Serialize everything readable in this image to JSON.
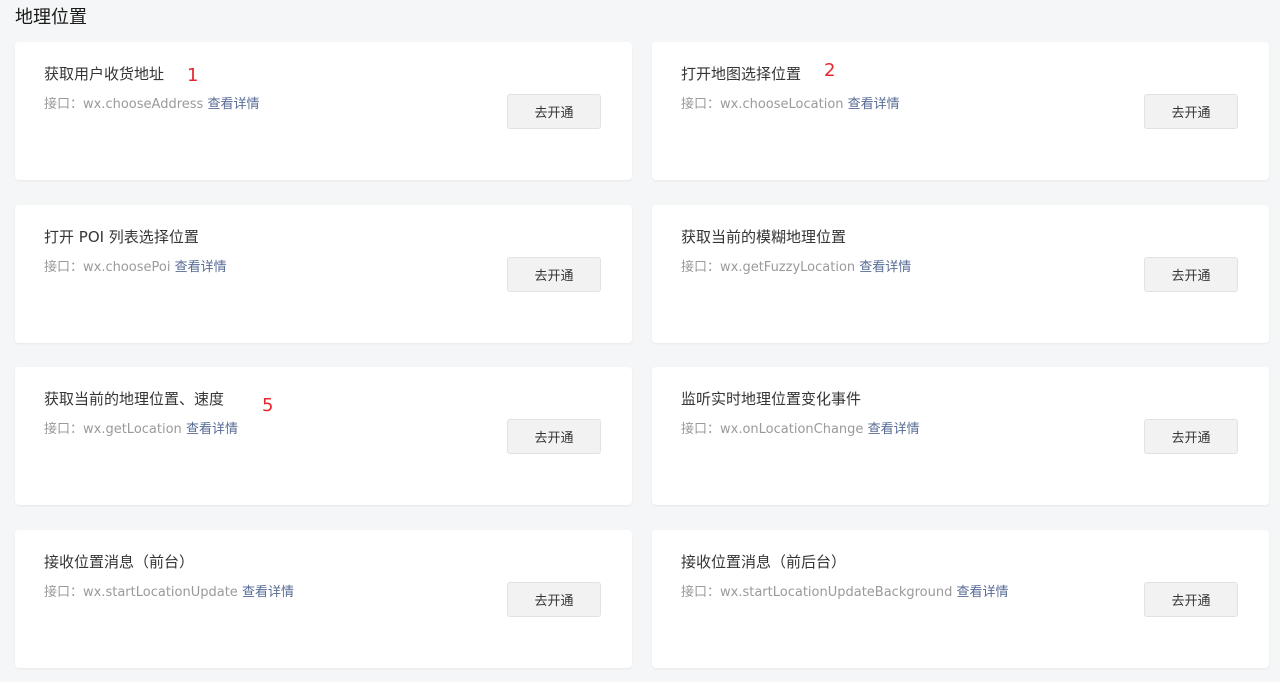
{
  "section_title": "地理位置",
  "cards": [
    {
      "title": "获取用户收货地址",
      "api_prefix": "接口：wx.chooseAddress",
      "detail": "查看详情",
      "button": "去开通",
      "marker": "1"
    },
    {
      "title": "打开地图选择位置",
      "api_prefix": "接口：wx.chooseLocation",
      "detail": "查看详情",
      "button": "去开通",
      "marker": "2"
    },
    {
      "title": "打开 POI 列表选择位置",
      "api_prefix": "接口：wx.choosePoi",
      "detail": "查看详情",
      "button": "去开通"
    },
    {
      "title": "获取当前的模糊地理位置",
      "api_prefix": "接口：wx.getFuzzyLocation",
      "detail": "查看详情",
      "button": "去开通"
    },
    {
      "title": "获取当前的地理位置、速度",
      "api_prefix": "接口：wx.getLocation",
      "detail": "查看详情",
      "button": "去开通",
      "marker": "5"
    },
    {
      "title": "监听实时地理位置变化事件",
      "api_prefix": "接口：wx.onLocationChange",
      "detail": "查看详情",
      "button": "去开通"
    },
    {
      "title": "接收位置消息（前台）",
      "api_prefix": "接口：wx.startLocationUpdate",
      "detail": "查看详情",
      "button": "去开通"
    },
    {
      "title": "接收位置消息（前后台）",
      "api_prefix": "接口：wx.startLocationUpdateBackground",
      "detail": "查看详情",
      "button": "去开通"
    }
  ],
  "colors": {
    "background": "#f5f6f7",
    "card": "#ffffff",
    "marker": "#e8262d",
    "muted_text": "#9a9a9a"
  }
}
